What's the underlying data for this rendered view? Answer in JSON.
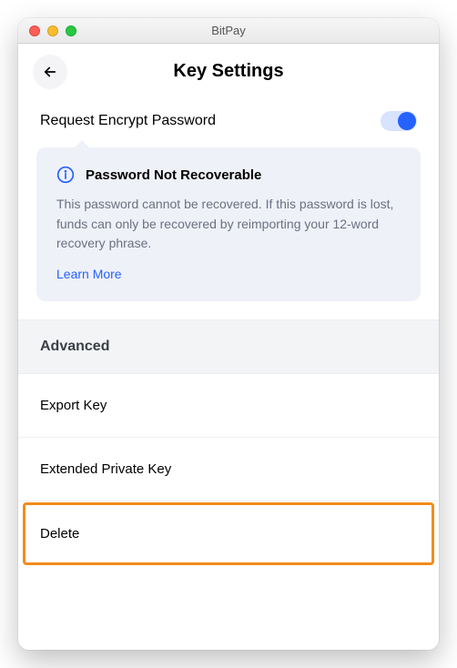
{
  "window": {
    "title": "BitPay"
  },
  "header": {
    "title": "Key Settings"
  },
  "toggle": {
    "label": "Request Encrypt Password",
    "on": true
  },
  "info": {
    "title": "Password Not Recoverable",
    "body": "This password cannot be recovered. If this password is lost, funds can only be recovered by reimporting your 12-word recovery phrase.",
    "learn_more": "Learn More"
  },
  "section": {
    "advanced": "Advanced"
  },
  "items": {
    "export_key": "Export Key",
    "extended_private_key": "Extended Private Key",
    "delete": "Delete"
  }
}
